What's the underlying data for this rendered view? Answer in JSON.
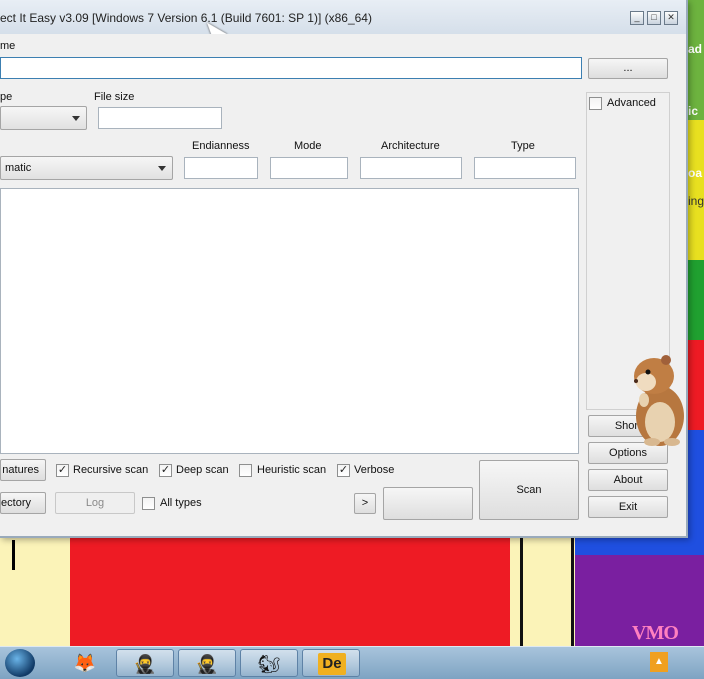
{
  "window": {
    "title": "ect It Easy v3.09 [Windows 7 Version 6.1 (Build 7601: SP 1)] (x86_64)",
    "minimize_glyph": "_",
    "maximize_glyph": "□",
    "close_glyph": "✕"
  },
  "file": {
    "label": "me",
    "path_value": "",
    "browse_label": "..."
  },
  "type_label": "pe",
  "file_size": {
    "label": "File size",
    "value": ""
  },
  "advanced_label": "Advanced",
  "scan_method": {
    "selected": "matic"
  },
  "columns": {
    "endianness": {
      "label": "Endianness",
      "value": ""
    },
    "mode": {
      "label": "Mode",
      "value": ""
    },
    "architecture": {
      "label": "Architecture",
      "value": ""
    },
    "type": {
      "label": "Type",
      "value": ""
    }
  },
  "options": {
    "signatures_label": "natures",
    "recursive_scan": {
      "label": "Recursive scan",
      "checked": true
    },
    "deep_scan": {
      "label": "Deep scan",
      "checked": true
    },
    "heuristic_scan": {
      "label": "Heuristic scan",
      "checked": false
    },
    "verbose": {
      "label": "Verbose",
      "checked": true
    },
    "directory_label": "ectory",
    "log_label": "Log",
    "all_types": {
      "label": "All types",
      "checked": false
    },
    "next_label": ">",
    "scan_label": "Scan"
  },
  "side_buttons": {
    "shortcuts_label": "Short",
    "options_label": "Options",
    "about_label": "About",
    "exit_label": "Exit"
  },
  "desktop": {
    "stripe_text_1": "ad",
    "stripe_text_2": "ic",
    "stripe_text_3": "oa",
    "stripe_text_4": "ing",
    "corner_text": "VMO"
  },
  "taskbar": {
    "items": [
      {
        "name": "firefox",
        "glyph": "🦊"
      },
      {
        "name": "app-ninja-1",
        "glyph": "🥷"
      },
      {
        "name": "app-ninja-2",
        "glyph": "🥷"
      },
      {
        "name": "app-squirrel",
        "glyph": "🐿"
      },
      {
        "name": "app-de",
        "glyph": "De"
      }
    ],
    "tray_arrow": "▲"
  }
}
